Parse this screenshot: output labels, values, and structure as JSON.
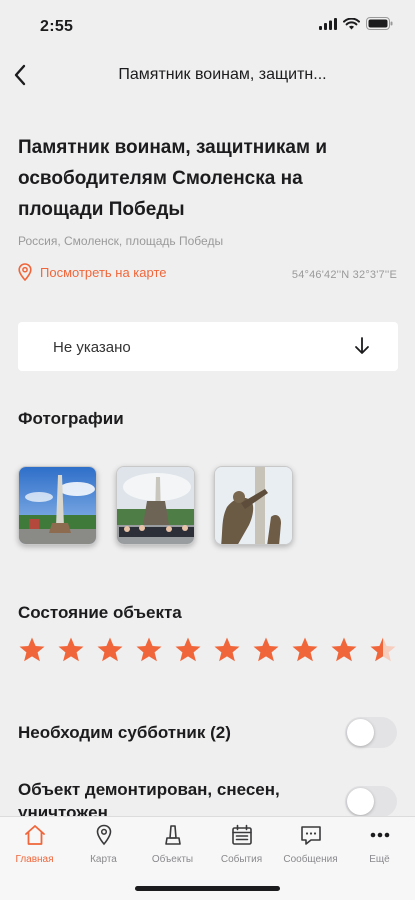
{
  "status_bar": {
    "time": "2:55"
  },
  "nav": {
    "title": "Памятник воинам, защитн..."
  },
  "object": {
    "title": "Памятник воинам, защитникам и освободителям Смоленска на площади Победы",
    "address": "Россия, Смоленск, площадь Победы",
    "map_link": "Посмотреть на карте",
    "coordinates": "54°46'42''N 32°3'7''E"
  },
  "dropdown": {
    "value": "Не указано"
  },
  "photos": {
    "title": "Фотографии",
    "count": 3
  },
  "condition": {
    "title": "Состояние объекта",
    "rating": 9.5,
    "max": 10
  },
  "toggles": [
    {
      "label": "Необходим субботник (2)",
      "on": false
    },
    {
      "label": "Объект демонтирован, снесен, уничтожен",
      "on": false
    }
  ],
  "tabs": [
    {
      "label": "Главная",
      "icon": "home-icon",
      "active": true
    },
    {
      "label": "Карта",
      "icon": "map-pin-icon",
      "active": false
    },
    {
      "label": "Объекты",
      "icon": "monument-icon",
      "active": false
    },
    {
      "label": "События",
      "icon": "calendar-icon",
      "active": false
    },
    {
      "label": "Сообщения",
      "icon": "chat-icon",
      "active": false
    },
    {
      "label": "Ещё",
      "icon": "more-icon",
      "active": false
    }
  ],
  "colors": {
    "accent": "#f0663a",
    "background": "#efefef",
    "inactive": "#8a8a8e"
  }
}
